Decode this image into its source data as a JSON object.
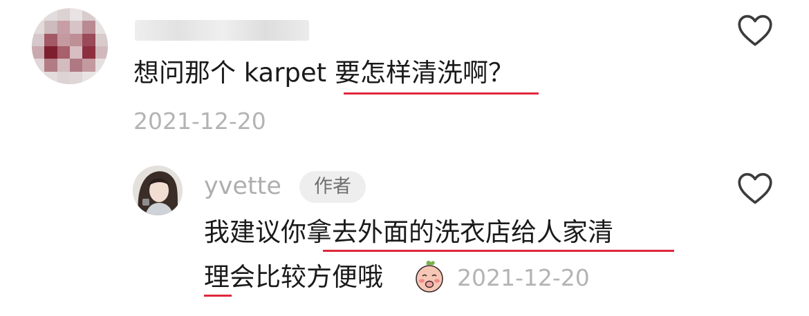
{
  "comment": {
    "text": "想问那个 karpet 要怎样清洗啊？",
    "date": "2021-12-20"
  },
  "reply": {
    "username": "yvette",
    "author_badge": "作者",
    "text_line1": "我建议你拿去外面的洗衣店给人家清",
    "text_line2": "理会比较方便哦",
    "date": "2021-12-20"
  },
  "colors": {
    "underline": "#e0263b",
    "muted_text": "#b3b3b3",
    "body_text": "#1a1a1a"
  },
  "icons": [
    "heart-icon",
    "emoji-sticker-icon"
  ]
}
